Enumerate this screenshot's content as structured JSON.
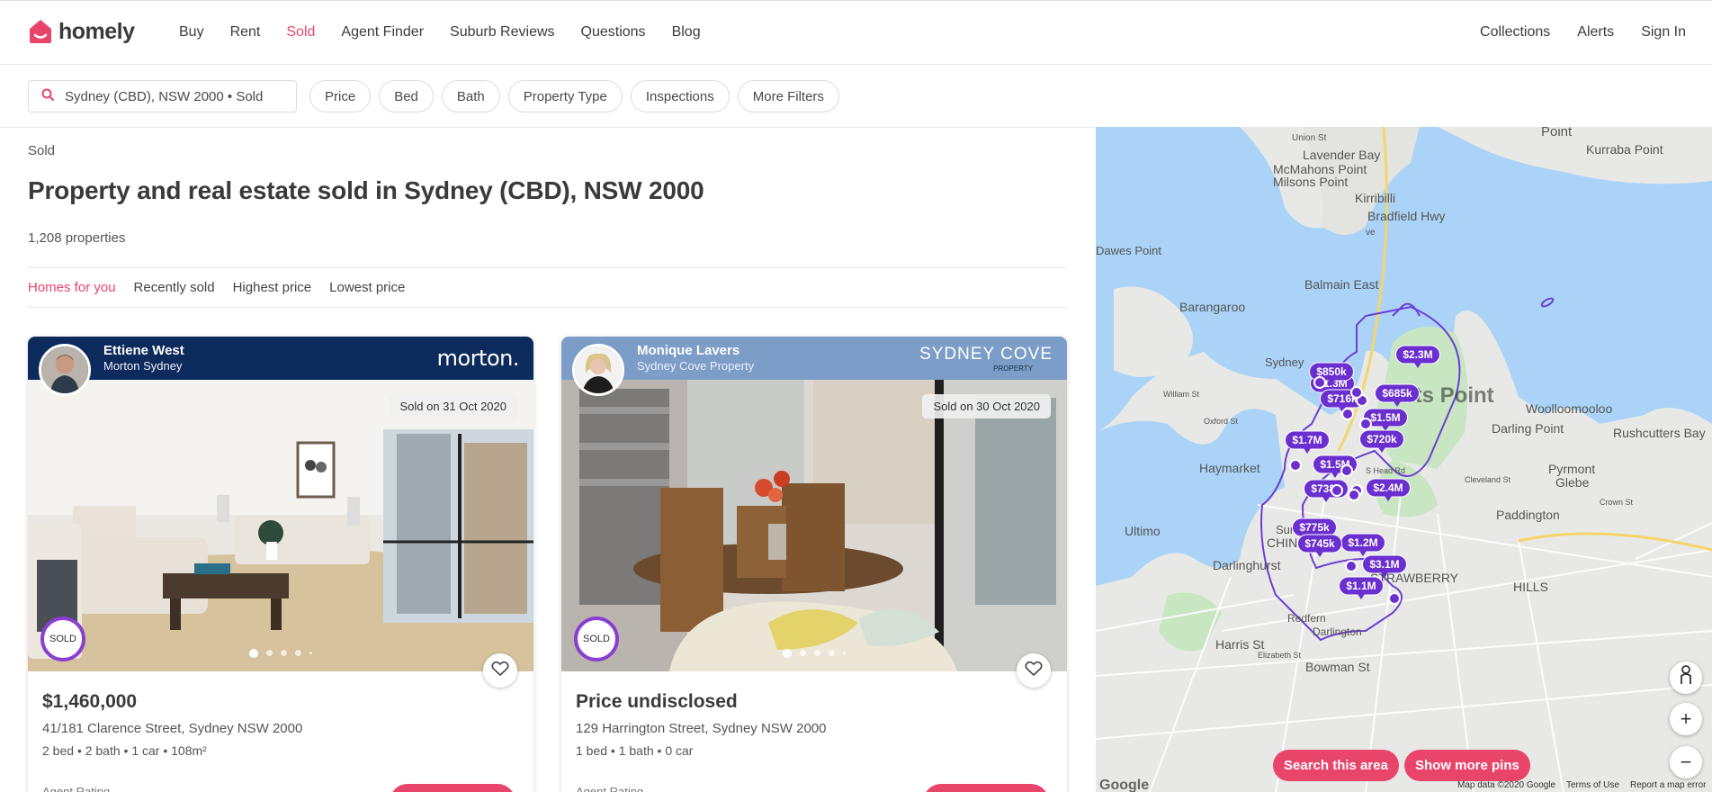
{
  "brand": {
    "name": "homely",
    "color": "#e9456b"
  },
  "nav": {
    "links": [
      "Buy",
      "Rent",
      "Sold",
      "Agent Finder",
      "Suburb Reviews",
      "Questions",
      "Blog"
    ],
    "active": "Sold",
    "right": [
      "Collections",
      "Alerts",
      "Sign In"
    ]
  },
  "search": {
    "value": "Sydney (CBD), NSW 2000 • Sold"
  },
  "filters": [
    "Price",
    "Bed",
    "Bath",
    "Property Type",
    "Inspections",
    "More Filters"
  ],
  "breadcrumb": "Sold",
  "page_title": "Property and real estate sold in Sydney (CBD), NSW 2000",
  "count": "1,208 properties",
  "sort": {
    "options": [
      "Homes for you",
      "Recently sold",
      "Highest price",
      "Lowest price"
    ],
    "active": "Homes for you"
  },
  "listings": [
    {
      "agent_name": "Ettiene West",
      "agency": "Morton Sydney",
      "brand_label": "morton.",
      "brand_color": "#0d2a5c",
      "sold_date": "Sold on 31 Oct 2020",
      "badge": "SOLD",
      "price": "$1,460,000",
      "address": "41/181 Clarence Street, Sydney NSW 2000",
      "features": "2 bed • 2 bath • 1 car • 108m²",
      "rating_label": "Agent Rating"
    },
    {
      "agent_name": "Monique Lavers",
      "agency": "Sydney Cove Property",
      "brand_label": "SYDNEY COVE",
      "brand_sub": "PROPERTY",
      "brand_color": "#7c9dc7",
      "sold_date": "Sold on 30 Oct 2020",
      "badge": "SOLD",
      "price": "Price undisclosed",
      "address": "129 Harrington Street, Sydney NSW 2000",
      "features": "1 bed • 1 bath • 0 car",
      "rating_label": "Agent Rating"
    }
  ],
  "map": {
    "labels": [
      "Union St",
      "Point",
      "Kurraba Point",
      "Lavender Bay",
      "McMahons Point",
      "Milsons Point",
      "Kirribilli",
      "Bradfield Hwy",
      "ve",
      "Dawes Point",
      "Balmain East",
      "Barangaroo",
      "Sydney",
      "Potts Point",
      "Woolloomooloo",
      "Darling Point",
      "Rushcutters Bay",
      "Pyrmont",
      "Glebe",
      "Haymarket",
      "Ultimo",
      "CHINATOWN",
      "Darlinghurst",
      "Surry Hills",
      "Paddington",
      "STRAWBERRY",
      "HILLS",
      "Redfern",
      "Darlington",
      "Bowman St",
      "Harris St",
      "William St",
      "Oxford St",
      "S Head Rd",
      "Cleveland St",
      "Crown St",
      "Elizabeth St"
    ],
    "pins": [
      "$2.3M",
      "$1.3M",
      "$685k",
      "$1.5M",
      "$1.7M",
      "$720k",
      "$1.5M",
      "$738k",
      "$2.4M",
      "$775k",
      "$1.2M",
      "$3.1M",
      "$1.1M",
      "$850k",
      "$716k",
      "$745k"
    ],
    "buttons": {
      "search_area": "Search this area",
      "more_pins": "Show more pins"
    },
    "attribution": [
      "Google",
      "Map data ©2020 Google",
      "Terms of Use",
      "Report a map error"
    ]
  }
}
